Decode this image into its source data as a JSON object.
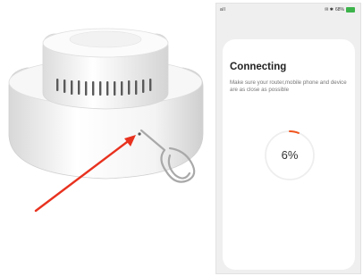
{
  "status_bar": {
    "signal_text": "all",
    "indicators_text": "✉ ✱",
    "battery_text": "68%",
    "battery_color": "#3cb34a"
  },
  "connecting_screen": {
    "title": "Connecting",
    "description": "Make sure your router,mobile phone and device are as close as possible",
    "progress_label": "6%",
    "progress_fraction": 0.06,
    "progress_color": "#f0541e",
    "track_color": "#eeeeee"
  },
  "product_photo": {
    "icons": [
      "smoke-detector-image",
      "sim-ejector-pin-image",
      "red-arrow-icon"
    ],
    "arrow_color": "#e8321f"
  }
}
